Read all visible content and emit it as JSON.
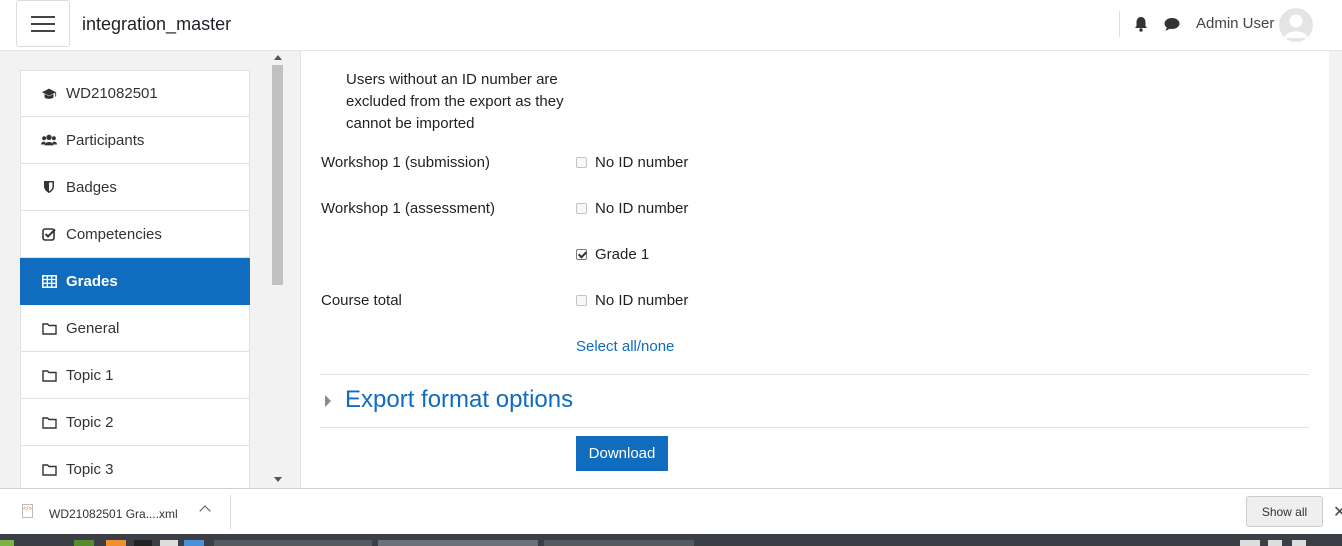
{
  "navbar": {
    "site_name": "integration_master",
    "user_name": "Admin User",
    "icons": [
      "menu-icon",
      "bell-icon",
      "message-icon",
      "avatar-icon"
    ]
  },
  "drawer": {
    "items": [
      {
        "label": "WD21082501",
        "icon": "graduation-cap-icon",
        "active": false
      },
      {
        "label": "Participants",
        "icon": "users-icon",
        "active": false
      },
      {
        "label": "Badges",
        "icon": "shield-icon",
        "active": false
      },
      {
        "label": "Competencies",
        "icon": "check-square-icon",
        "active": false
      },
      {
        "label": "Grades",
        "icon": "table-icon",
        "active": true
      },
      {
        "label": "General",
        "icon": "folder-icon",
        "active": false
      },
      {
        "label": "Topic 1",
        "icon": "folder-icon",
        "active": false
      },
      {
        "label": "Topic 2",
        "icon": "folder-icon",
        "active": false
      },
      {
        "label": "Topic 3",
        "icon": "folder-icon",
        "active": false
      }
    ]
  },
  "main": {
    "note": "Users without an ID number are excluded from the export as they cannot be imported",
    "rows": [
      {
        "label": "Workshop 1 (submission)",
        "option": "No ID number",
        "checked": false
      },
      {
        "label": "Workshop 1 (assessment)",
        "option": "No ID number",
        "checked": false
      },
      {
        "label": "",
        "option": "Grade 1",
        "checked": true
      },
      {
        "label": "Course total",
        "option": "No ID number",
        "checked": false
      }
    ],
    "select_all_link": "Select all/none",
    "section_title": "Export format options",
    "download_button": "Download"
  },
  "download_bar": {
    "file_name": "WD21082501 Gra....xml",
    "show_all": "Show all",
    "close": "✕"
  },
  "colors": {
    "accent": "#0f6cbf",
    "drawer_bg": "#f2f2f2"
  }
}
